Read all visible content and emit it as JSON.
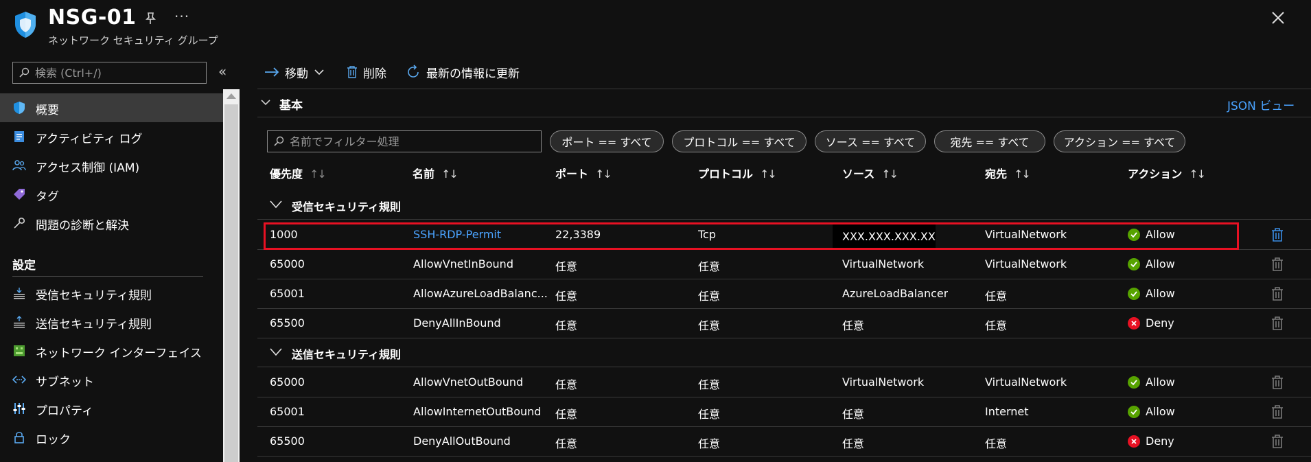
{
  "header": {
    "title": "NSG-01",
    "subtitle": "ネットワーク セキュリティ グループ",
    "more_label": "···"
  },
  "sidebar": {
    "search_placeholder": "検索 (Ctrl+/)",
    "collapse_label": "«",
    "items": [
      {
        "label": "概要",
        "icon": "shield-icon"
      },
      {
        "label": "アクティビティ ログ",
        "icon": "activity-log-icon"
      },
      {
        "label": "アクセス制御 (IAM)",
        "icon": "iam-icon"
      },
      {
        "label": "タグ",
        "icon": "tag-icon"
      },
      {
        "label": "問題の診断と解決",
        "icon": "wrench-icon"
      }
    ],
    "settings_header": "設定",
    "settings_items": [
      {
        "label": "受信セキュリティ規則",
        "icon": "inbound-rules-icon"
      },
      {
        "label": "送信セキュリティ規則",
        "icon": "outbound-rules-icon"
      },
      {
        "label": "ネットワーク インターフェイス",
        "icon": "network-interface-icon"
      },
      {
        "label": "サブネット",
        "icon": "subnet-icon"
      },
      {
        "label": "プロパティ",
        "icon": "properties-icon"
      },
      {
        "label": "ロック",
        "icon": "lock-icon"
      }
    ]
  },
  "toolbar": {
    "move_label": "移動",
    "delete_label": "削除",
    "refresh_label": "最新の情報に更新"
  },
  "essentials": {
    "label": "基本",
    "json_view_label": "JSON ビュー"
  },
  "filters": {
    "name_placeholder": "名前でフィルター処理",
    "pills": [
      "ポート == すべて",
      "プロトコル == すべて",
      "ソース == すべて",
      "宛先 == すべて",
      "アクション == すべて"
    ]
  },
  "table": {
    "columns": [
      "優先度",
      "名前",
      "ポート",
      "プロトコル",
      "ソース",
      "宛先",
      "アクション"
    ],
    "sort_glyph": "↑↓",
    "groups": [
      {
        "label": "受信セキュリティ規則",
        "rows": [
          {
            "priority": "1000",
            "name": "SSH-RDP-Permit",
            "port": "22,3389",
            "protocol": "Tcp",
            "source": "XXX.XXX.XXX.XXX",
            "destination": "VirtualNetwork",
            "action": "Allow"
          },
          {
            "priority": "65000",
            "name": "AllowVnetInBound",
            "port": "任意",
            "protocol": "任意",
            "source": "VirtualNetwork",
            "destination": "VirtualNetwork",
            "action": "Allow"
          },
          {
            "priority": "65001",
            "name": "AllowAzureLoadBalanc...",
            "port": "任意",
            "protocol": "任意",
            "source": "AzureLoadBalancer",
            "destination": "任意",
            "action": "Allow"
          },
          {
            "priority": "65500",
            "name": "DenyAllInBound",
            "port": "任意",
            "protocol": "任意",
            "source": "任意",
            "destination": "任意",
            "action": "Deny"
          }
        ]
      },
      {
        "label": "送信セキュリティ規則",
        "rows": [
          {
            "priority": "65000",
            "name": "AllowVnetOutBound",
            "port": "任意",
            "protocol": "任意",
            "source": "VirtualNetwork",
            "destination": "VirtualNetwork",
            "action": "Allow"
          },
          {
            "priority": "65001",
            "name": "AllowInternetOutBound",
            "port": "任意",
            "protocol": "任意",
            "source": "任意",
            "destination": "Internet",
            "action": "Allow"
          },
          {
            "priority": "65500",
            "name": "DenyAllOutBound",
            "port": "任意",
            "protocol": "任意",
            "source": "任意",
            "destination": "任意",
            "action": "Deny"
          }
        ]
      }
    ]
  },
  "colors": {
    "accent": "#4aa3ff",
    "allow": "#57a300",
    "deny": "#e81123",
    "highlight": "#e81123"
  }
}
